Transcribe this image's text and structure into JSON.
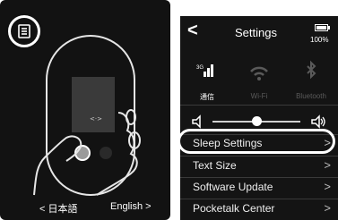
{
  "left_panel": {
    "menu_icon": "menu-icon",
    "language_bar": {
      "left_label": "< 日本語",
      "right_label": "English >"
    }
  },
  "settings": {
    "title": "Settings",
    "back_icon": "chevron-left-icon",
    "battery_label": "100%",
    "connectivity": [
      {
        "label": "通信",
        "icon": "cellular-icon",
        "badge": "3G",
        "enabled": true
      },
      {
        "label": "Wi-Fi",
        "icon": "wifi-icon",
        "enabled": false
      },
      {
        "label": "Bluetooth",
        "icon": "bluetooth-icon",
        "enabled": false
      }
    ],
    "volume": {
      "level": 0.5
    },
    "menu": [
      {
        "label": "Sleep Settings",
        "chevron": ">"
      },
      {
        "label": "Text Size",
        "chevron": ">"
      },
      {
        "label": "Software Update",
        "chevron": ">"
      },
      {
        "label": "Pocketalk Center",
        "chevron": ">"
      }
    ]
  },
  "colors": {
    "screen_bg": "#141414",
    "text": "#ffffff",
    "disabled": "#5a5a5a"
  }
}
